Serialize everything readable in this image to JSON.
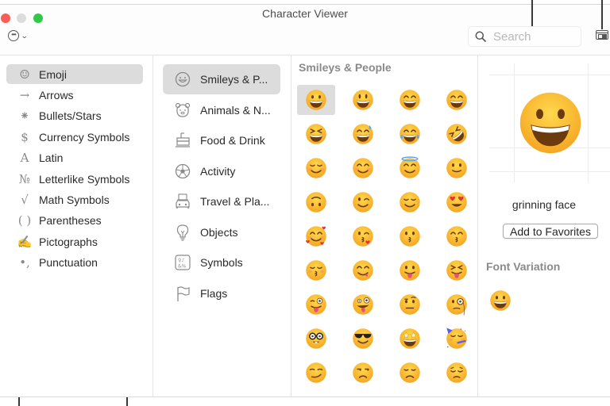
{
  "window": {
    "title": "Character Viewer",
    "traffic_lights": [
      "close",
      "minimize-disabled",
      "zoom"
    ],
    "more_menu_icon": "ellipsis-circle-icon"
  },
  "search": {
    "placeholder": "Search",
    "value": "",
    "icon": "magnifier-icon"
  },
  "view_toggle_icon": "compact-view-icon",
  "categories": [
    {
      "label": "Emoji",
      "icon": "☺",
      "selected": true
    },
    {
      "label": "Arrows",
      "icon": "→",
      "selected": false
    },
    {
      "label": "Bullets/Stars",
      "icon": "⁕",
      "selected": false
    },
    {
      "label": "Currency Symbols",
      "icon": "$",
      "selected": false
    },
    {
      "label": "Latin",
      "icon": "A",
      "selected": false
    },
    {
      "label": "Letterlike Symbols",
      "icon": "№",
      "selected": false
    },
    {
      "label": "Math Symbols",
      "icon": "√",
      "selected": false
    },
    {
      "label": "Parentheses",
      "icon": "( )",
      "selected": false
    },
    {
      "label": "Pictographs",
      "icon": "✍",
      "selected": false
    },
    {
      "label": "Punctuation",
      "icon": "•,",
      "selected": false
    }
  ],
  "subcategories": [
    {
      "label": "Smileys & P...",
      "icon": "smiley-icon",
      "selected": true
    },
    {
      "label": "Animals & N...",
      "icon": "bear-icon",
      "selected": false
    },
    {
      "label": "Food & Drink",
      "icon": "cake-icon",
      "selected": false
    },
    {
      "label": "Activity",
      "icon": "soccer-ball-icon",
      "selected": false
    },
    {
      "label": "Travel & Pla...",
      "icon": "car-building-icon",
      "selected": false
    },
    {
      "label": "Objects",
      "icon": "lightbulb-icon",
      "selected": false
    },
    {
      "label": "Symbols",
      "icon": "symbols-icon",
      "selected": false
    },
    {
      "label": "Flags",
      "icon": "flag-icon",
      "selected": false
    }
  ],
  "grid": {
    "section_title": "Smileys & People",
    "emojis": [
      {
        "name": "grinning face",
        "type": "grin",
        "selected": true
      },
      {
        "name": "grinning face with big eyes",
        "type": "grin-big"
      },
      {
        "name": "grinning face with smiling eyes",
        "type": "grin-smile"
      },
      {
        "name": "beaming face with smiling eyes",
        "type": "beam"
      },
      {
        "name": "grinning squinting face",
        "type": "squint"
      },
      {
        "name": "grinning face with sweat",
        "type": "sweat"
      },
      {
        "name": "face with tears of joy",
        "type": "tears"
      },
      {
        "name": "rolling on the floor laughing",
        "type": "rofl"
      },
      {
        "name": "smiling face",
        "type": "relaxed"
      },
      {
        "name": "smiling face with smiling eyes",
        "type": "blush"
      },
      {
        "name": "smiling face with halo",
        "type": "halo"
      },
      {
        "name": "slightly smiling face",
        "type": "slight"
      },
      {
        "name": "upside-down face",
        "type": "upside"
      },
      {
        "name": "winking face",
        "type": "wink"
      },
      {
        "name": "relieved face",
        "type": "relieved"
      },
      {
        "name": "smiling face with heart-eyes",
        "type": "hearteyes"
      },
      {
        "name": "smiling face with hearts",
        "type": "hearts"
      },
      {
        "name": "face blowing a kiss",
        "type": "blowkiss"
      },
      {
        "name": "kissing face",
        "type": "kiss"
      },
      {
        "name": "kissing face with smiling eyes",
        "type": "kiss-smile"
      },
      {
        "name": "kissing face with closed eyes",
        "type": "kiss-closed"
      },
      {
        "name": "face savoring food",
        "type": "yum"
      },
      {
        "name": "face with tongue",
        "type": "tongue"
      },
      {
        "name": "squinting face with tongue",
        "type": "tongue-squint"
      },
      {
        "name": "winking face with tongue",
        "type": "tongue-wink"
      },
      {
        "name": "zany face",
        "type": "zany"
      },
      {
        "name": "face with raised eyebrow",
        "type": "raised"
      },
      {
        "name": "face with monocle",
        "type": "monocle"
      },
      {
        "name": "nerd face",
        "type": "nerd"
      },
      {
        "name": "smiling face with sunglasses",
        "type": "cool"
      },
      {
        "name": "star-struck",
        "type": "star"
      },
      {
        "name": "partying face",
        "type": "party"
      },
      {
        "name": "smirking face",
        "type": "smirk"
      },
      {
        "name": "unamused face",
        "type": "unamused"
      },
      {
        "name": "disappointed face",
        "type": "disappointed"
      },
      {
        "name": "pensive face",
        "type": "pensive"
      }
    ]
  },
  "detail": {
    "character_name": "grinning face",
    "add_favorites_label": "Add to Favorites",
    "font_variation_title": "Font Variation"
  },
  "colors": {
    "selection": "#dcdcdc",
    "face_top": "#ffd84d",
    "face_bottom": "#f5a623",
    "feature": "#6b3a0e",
    "section_gray": "#8a8a8a"
  }
}
